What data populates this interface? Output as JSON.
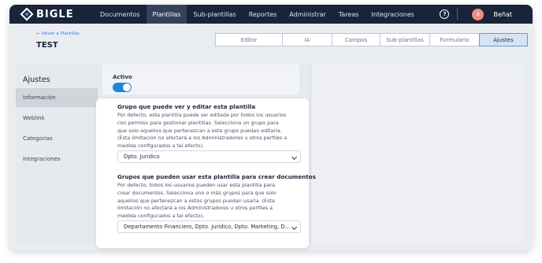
{
  "app": {
    "logo_text": "BIGLE",
    "logo_icon": "diamond-logo-icon"
  },
  "nav": {
    "items": [
      {
        "label": "Documentos",
        "active": false
      },
      {
        "label": "Plantillas",
        "active": true
      },
      {
        "label": "Sub-plantillas",
        "active": false
      },
      {
        "label": "Reportes",
        "active": false
      },
      {
        "label": "Administrar",
        "active": false
      },
      {
        "label": "Tareas",
        "active": false
      },
      {
        "label": "Integraciones",
        "active": false
      }
    ],
    "help_icon": "?",
    "user": {
      "initial": "B",
      "name": "Beñat"
    }
  },
  "header": {
    "back_link": "← Volver a Plantillas",
    "title": "TEST",
    "tabs": [
      {
        "label": "Editor",
        "active": false
      },
      {
        "label": "IA",
        "active": false
      },
      {
        "label": "Campos",
        "active": false
      },
      {
        "label": "Sub-plantillas",
        "active": false
      },
      {
        "label": "Formulario",
        "active": false
      },
      {
        "label": "Ajustes",
        "active": true
      }
    ]
  },
  "sidebar": {
    "title": "Ajustes",
    "items": [
      {
        "label": "Información",
        "active": true
      },
      {
        "label": "Weblink",
        "active": false
      },
      {
        "label": "Categorías",
        "active": false
      },
      {
        "label": "Integraciones",
        "active": false
      }
    ]
  },
  "settings": {
    "active_label": "Activo",
    "active_on": true,
    "edit_group": {
      "title": "Grupo que puede ver y editar esta plantilla",
      "description_lines": [
        "Por defecto, esta plantilla puede ser editada por todos los usuarios",
        "con permiso para gestionar plantillas. Selecciona un grupo para",
        "que solo aquellos que pertenezcan a este grupo puedan editarla.",
        "(Esta limitación no afectará a los Administradores u otros perfiles a",
        "medida configurados a tal efecto)."
      ],
      "selected": "Dpto. Juridico"
    },
    "use_groups": {
      "title": "Grupos que pueden usar esta plantilla para crear documentos",
      "description_lines": [
        "Por defecto, todos los usuarios pueden usar esta plantilla para",
        "crear documentos. Selecciona uno o más grupos para que solo",
        "aquellos que pertenezcan a estos grupos puedan usarla. (Esta",
        "limitación no afectará a los Administradores u otros perfiles a",
        "medida configurados a tal efecto)."
      ],
      "selected": "Departamento Financiero, Dpto. Juridico, Dpto. Marketing, D..."
    }
  }
}
